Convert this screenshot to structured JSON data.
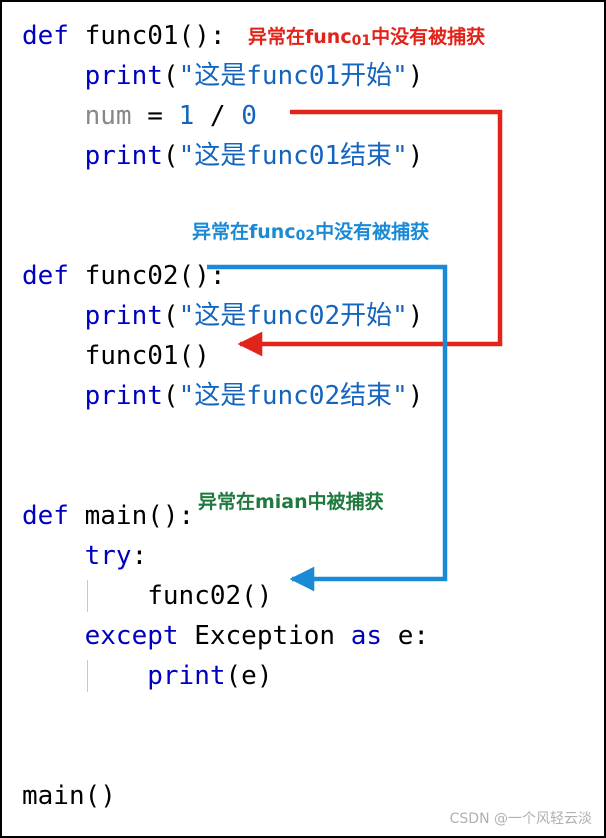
{
  "code": {
    "lines": [
      {
        "id": "l1",
        "indent": 0,
        "tokens": [
          {
            "t": "def ",
            "c": "kw"
          },
          {
            "t": "func01():",
            "c": "fn"
          }
        ]
      },
      {
        "id": "l2",
        "indent": 1,
        "tokens": [
          {
            "t": "print",
            "c": "kw2"
          },
          {
            "t": "(",
            "c": "op"
          },
          {
            "t": "\"这是func01开始\"",
            "c": "str"
          },
          {
            "t": ")",
            "c": "op"
          }
        ]
      },
      {
        "id": "l3",
        "indent": 1,
        "tokens": [
          {
            "t": "num",
            "c": "var"
          },
          {
            "t": " = ",
            "c": "op"
          },
          {
            "t": "1",
            "c": "num"
          },
          {
            "t": " / ",
            "c": "op"
          },
          {
            "t": "0",
            "c": "num"
          }
        ]
      },
      {
        "id": "l4",
        "indent": 1,
        "tokens": [
          {
            "t": "print",
            "c": "kw2"
          },
          {
            "t": "(",
            "c": "op"
          },
          {
            "t": "\"这是func01结束\"",
            "c": "str"
          },
          {
            "t": ")",
            "c": "op"
          }
        ]
      },
      {
        "id": "l5",
        "indent": 0,
        "tokens": []
      },
      {
        "id": "l6",
        "indent": 0,
        "tokens": []
      },
      {
        "id": "l7",
        "indent": 0,
        "tokens": [
          {
            "t": "def ",
            "c": "kw"
          },
          {
            "t": "func02():",
            "c": "fn"
          }
        ]
      },
      {
        "id": "l8",
        "indent": 1,
        "tokens": [
          {
            "t": "print",
            "c": "kw2"
          },
          {
            "t": "(",
            "c": "op"
          },
          {
            "t": "\"这是func02开始\"",
            "c": "str"
          },
          {
            "t": ")",
            "c": "op"
          }
        ]
      },
      {
        "id": "l9",
        "indent": 1,
        "tokens": [
          {
            "t": "func01()",
            "c": "fn"
          }
        ]
      },
      {
        "id": "l10",
        "indent": 1,
        "tokens": [
          {
            "t": "print",
            "c": "kw2"
          },
          {
            "t": "(",
            "c": "op"
          },
          {
            "t": "\"这是func02结束\"",
            "c": "str"
          },
          {
            "t": ")",
            "c": "op"
          }
        ]
      },
      {
        "id": "l11",
        "indent": 0,
        "tokens": []
      },
      {
        "id": "l12",
        "indent": 0,
        "tokens": []
      },
      {
        "id": "l13",
        "indent": 0,
        "tokens": [
          {
            "t": "def ",
            "c": "kw"
          },
          {
            "t": "main():",
            "c": "fn"
          }
        ]
      },
      {
        "id": "l14",
        "indent": 1,
        "tokens": [
          {
            "t": "try",
            "c": "kw"
          },
          {
            "t": ":",
            "c": "op"
          }
        ]
      },
      {
        "id": "l15",
        "indent": 2,
        "tokens": [
          {
            "t": "func02()",
            "c": "fn"
          }
        ]
      },
      {
        "id": "l16",
        "indent": 1,
        "tokens": [
          {
            "t": "except ",
            "c": "kw"
          },
          {
            "t": "Exception ",
            "c": "fn"
          },
          {
            "t": "as ",
            "c": "kw"
          },
          {
            "t": "e:",
            "c": "fn"
          }
        ]
      },
      {
        "id": "l17",
        "indent": 2,
        "tokens": [
          {
            "t": "print",
            "c": "kw2"
          },
          {
            "t": "(e)",
            "c": "op"
          }
        ]
      },
      {
        "id": "l18",
        "indent": 0,
        "tokens": []
      },
      {
        "id": "l19",
        "indent": 0,
        "tokens": []
      },
      {
        "id": "l20",
        "indent": 0,
        "tokens": [
          {
            "t": "main()",
            "c": "fn"
          }
        ]
      }
    ]
  },
  "annotations": {
    "func01_uncaught": {
      "pre": "异常在func",
      "sub": "01",
      "post": "中没有被捕获",
      "color": "#e2231a"
    },
    "func02_uncaught": {
      "pre": "异常在func",
      "sub": "02",
      "post": "中没有被捕获",
      "color": "#1b8ad6"
    },
    "main_caught": {
      "pre": "异常在mian中被捕获",
      "sub": "",
      "post": "",
      "color": "#1f7a3f"
    }
  },
  "arrows": {
    "red": {
      "color": "#e2231a",
      "label": "exception-propagation-func01-to-func02"
    },
    "blue": {
      "color": "#1b8ad6",
      "label": "exception-propagation-func02-to-main"
    }
  },
  "watermark": {
    "text": "CSDN @一个风轻云淡"
  }
}
